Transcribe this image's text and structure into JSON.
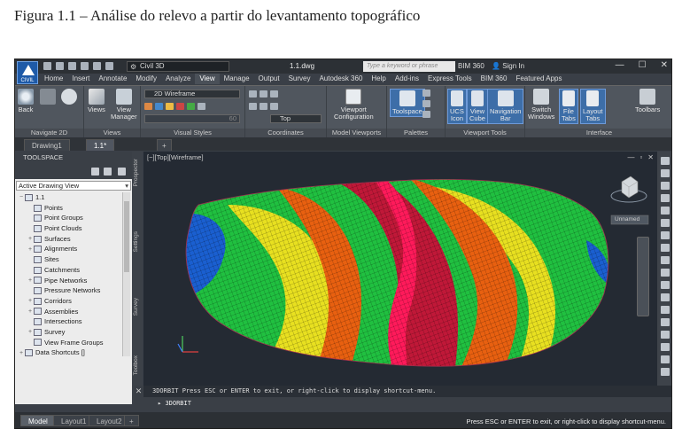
{
  "caption": "Figura 1.1 – Análise do relevo a partir do levantamento topográfico",
  "titlebar": {
    "logo_label": "CIVIL",
    "workspace": "Civil 3D",
    "document": "1.1.dwg",
    "search_placeholder": "Type a keyword or phrase",
    "bim": "BIM 360",
    "signin": "Sign In",
    "help": "?"
  },
  "menu_tabs": [
    "Home",
    "Insert",
    "Annotate",
    "Modify",
    "Analyze",
    "View",
    "Manage",
    "Output",
    "Survey",
    "Autodesk 360",
    "Help",
    "Add-ins",
    "Express Tools",
    "BIM 360",
    "Featured Apps"
  ],
  "active_menu_tab": "View",
  "ribbon": {
    "back": "Back",
    "views": "Views",
    "view_manager": "View\nManager",
    "visual_style": "2D Wireframe",
    "ucs_view": "Top",
    "viewport_config": "Viewport\nConfiguration",
    "toolspace": "Toolspace",
    "ucs_icon": "UCS\nIcon",
    "view_cube": "View\nCube",
    "navigation_bar": "Navigation\nBar",
    "switch_windows": "Switch\nWindows",
    "file_tabs": "File\nTabs",
    "layout_tabs": "Layout\nTabs",
    "toolbars": "Toolbars",
    "opacity_value": "60",
    "panels": [
      "Navigate 2D",
      "Views",
      "Visual Styles",
      "Coordinates",
      "Model Viewports",
      "Palettes",
      "Viewport Tools",
      "Interface"
    ]
  },
  "doc_tabs": [
    "Drawing1",
    "1.1*"
  ],
  "toolspace": {
    "title": "TOOLSPACE",
    "view_select": "Active Drawing View",
    "tree": [
      {
        "label": "1.1",
        "level": 0,
        "expander": "−"
      },
      {
        "label": "Points",
        "level": 1,
        "expander": ""
      },
      {
        "label": "Point Groups",
        "level": 1,
        "expander": ""
      },
      {
        "label": "Point Clouds",
        "level": 1,
        "expander": ""
      },
      {
        "label": "Surfaces",
        "level": 1,
        "expander": "+"
      },
      {
        "label": "Alignments",
        "level": 1,
        "expander": "+"
      },
      {
        "label": "Sites",
        "level": 1,
        "expander": ""
      },
      {
        "label": "Catchments",
        "level": 1,
        "expander": ""
      },
      {
        "label": "Pipe Networks",
        "level": 1,
        "expander": "+"
      },
      {
        "label": "Pressure Networks",
        "level": 1,
        "expander": ""
      },
      {
        "label": "Corridors",
        "level": 1,
        "expander": "+"
      },
      {
        "label": "Assemblies",
        "level": 1,
        "expander": "+"
      },
      {
        "label": "Intersections",
        "level": 1,
        "expander": ""
      },
      {
        "label": "Survey",
        "level": 1,
        "expander": "+"
      },
      {
        "label": "View Frame Groups",
        "level": 1,
        "expander": ""
      },
      {
        "label": "Data Shortcuts []",
        "level": 0,
        "expander": "+"
      }
    ],
    "side_tabs": [
      "Prospector",
      "Settings",
      "Survey",
      "Toolbox"
    ]
  },
  "viewport": {
    "label": "[−][Top][Wireframe]",
    "viewcube_label": "Unnamed"
  },
  "command": {
    "history": "3DORBIT Press ESC or ENTER to exit, or right-click to display shortcut-menu.",
    "current": "3DORBIT"
  },
  "layout_tabs": [
    "Model",
    "Layout1",
    "Layout2"
  ],
  "status_message": "Press ESC or ENTER to exit, or right-click to display shortcut-menu.",
  "colors": {
    "terrain_low": "#1a5fd0",
    "terrain_mid_low": "#20c040",
    "terrain_mid": "#e8e020",
    "terrain_high": "#e86010",
    "terrain_peak": "#ff1a5a"
  }
}
